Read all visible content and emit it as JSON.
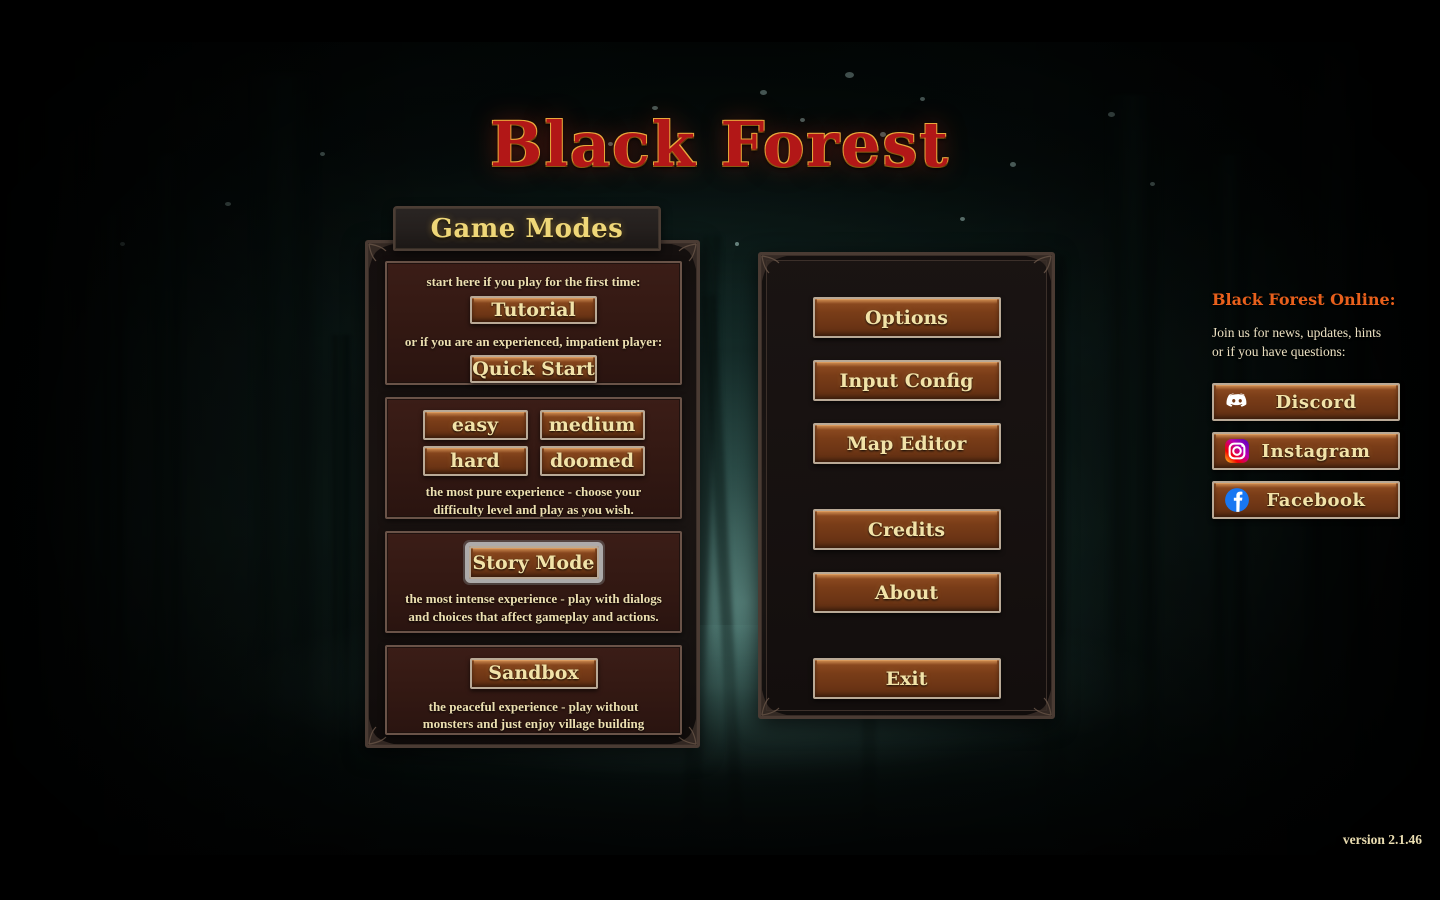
{
  "game": {
    "title": "Black Forest",
    "version": "version 2.1.46"
  },
  "game_modes": {
    "header": "Game Modes",
    "start_section": {
      "first_time_hint": "start here if you play for the first time:",
      "tutorial_label": "Tutorial",
      "experienced_hint": "or if you are an experienced, impatient player:",
      "quick_start_label": "Quick Start"
    },
    "difficulty_section": {
      "easy_label": "easy",
      "medium_label": "medium",
      "hard_label": "hard",
      "doomed_label": "doomed",
      "description_line1": "the most pure experience - choose your",
      "description_line2": "difficulty level and play as you wish."
    },
    "story_section": {
      "story_mode_label": "Story Mode",
      "description_line1": "the most intense experience - play with dialogs",
      "description_line2": "and choices that affect gameplay and actions.",
      "selected": true
    },
    "sandbox_section": {
      "sandbox_label": "Sandbox",
      "description_line1": "the peaceful experience - play without",
      "description_line2": "monsters and just enjoy village building"
    }
  },
  "main_menu": {
    "options_label": "Options",
    "input_config_label": "Input Config",
    "map_editor_label": "Map Editor",
    "credits_label": "Credits",
    "about_label": "About",
    "exit_label": "Exit"
  },
  "online": {
    "title": "Black Forest Online:",
    "subtitle_line1": "Join us for news, updates, hints",
    "subtitle_line2": "or if you have questions:",
    "links": [
      {
        "label": "Discord",
        "icon": "discord-icon"
      },
      {
        "label": "Instagram",
        "icon": "instagram-icon"
      },
      {
        "label": "Facebook",
        "icon": "facebook-icon"
      }
    ]
  },
  "colors": {
    "title_red": "#b21717",
    "title_outline_gold": "#e8a93c",
    "header_gold": "#efd778",
    "button_face": "#7a3d18",
    "button_border": "#b9a996",
    "button_text": "#f2e3a8",
    "panel_border": "#4a3b33",
    "section_face": "#341913",
    "online_orange": "#e8601c",
    "hint_cream": "#ecdfb0",
    "selection_glow": "#c4c4c4",
    "forest_teal": "#6eb4ac",
    "letterbox": "#000000"
  }
}
